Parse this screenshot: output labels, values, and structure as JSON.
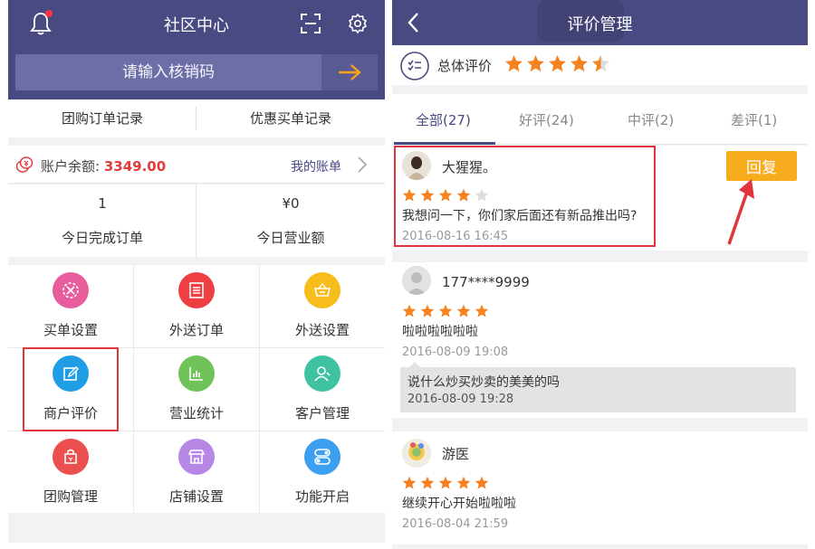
{
  "left": {
    "header": {
      "title": "社区中心"
    },
    "code_input": {
      "placeholder": "请输入核销码"
    },
    "tabs": [
      {
        "label": "团购订单记录"
      },
      {
        "label": "优惠买单记录"
      }
    ],
    "account": {
      "label": "账户余额: ",
      "value": "3349.00",
      "bill_link": "我的账单"
    },
    "stats": [
      {
        "value": "1",
        "label": "今日完成订单"
      },
      {
        "value": "¥0",
        "label": "今日营业额"
      }
    ],
    "grid": [
      {
        "label": "买单设置",
        "icon": "buy-settings-icon",
        "color": "#e85d9d"
      },
      {
        "label": "外送订单",
        "icon": "delivery-order-icon",
        "color": "#ef3f43"
      },
      {
        "label": "外送设置",
        "icon": "delivery-settings-icon",
        "color": "#f7bd1d"
      },
      {
        "label": "商户评价",
        "icon": "merchant-review-icon",
        "color": "#1f9ee5"
      },
      {
        "label": "营业统计",
        "icon": "business-stats-icon",
        "color": "#6fc35a"
      },
      {
        "label": "客户管理",
        "icon": "customer-management-icon",
        "color": "#3fc2a2"
      },
      {
        "label": "团购管理",
        "icon": "group-buy-management-icon",
        "color": "#ec4f4f"
      },
      {
        "label": "店铺设置",
        "icon": "store-settings-icon",
        "color": "#b787e6"
      },
      {
        "label": "功能开启",
        "icon": "feature-toggle-icon",
        "color": "#3d9ff0"
      }
    ]
  },
  "right": {
    "header": {
      "title": "评价管理"
    },
    "overall": {
      "label": "总体评价",
      "rating": 4.5,
      "max": 5
    },
    "tabs": [
      {
        "label": "全部(27)",
        "active": true
      },
      {
        "label": "好评(24)"
      },
      {
        "label": "中评(2)"
      },
      {
        "label": "差评(1)"
      }
    ],
    "reply_button": "回复",
    "reviews": [
      {
        "name": "大猩猩。",
        "rating": 4,
        "text": "我想问一下，你们家后面还有新品推出吗?",
        "time": "2016-08-16 16:45"
      },
      {
        "name": "177****9999",
        "rating": 5,
        "text": "啦啦啦啦啦啦",
        "time": "2016-08-09 19:08",
        "reply": {
          "text": "说什么炒买炒卖的美美的吗",
          "time": "2016-08-09 19:28"
        }
      },
      {
        "name": "游医",
        "rating": 5,
        "text": "继续开心开始啦啦啦",
        "time": "2016-08-04 21:59"
      }
    ]
  },
  "colors": {
    "header": "#4a4a83",
    "star": "#f58220",
    "accent_red": "#e23b3b",
    "reply_button": "#f7ac1d",
    "highlight": "#e0353a"
  }
}
